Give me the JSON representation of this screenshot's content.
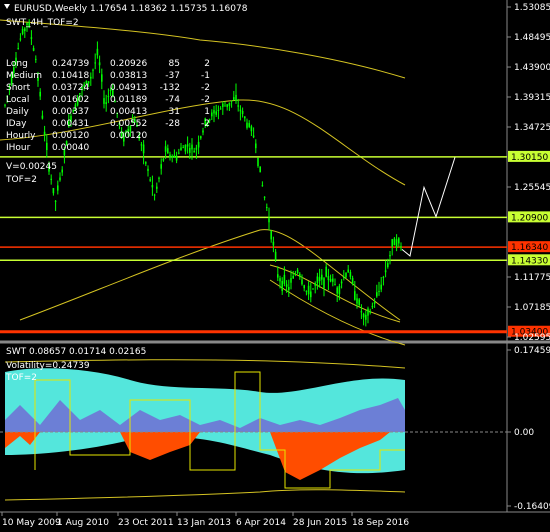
{
  "header": {
    "symbol_line": "EURUSD,Weekly  1.17654 1.18362 1.15735 1.16078",
    "indicator_name": "SWT_4H_TOF=2"
  },
  "stats": {
    "rows": [
      {
        "label": "Long",
        "v1": "0.24739",
        "v2": "0.20926",
        "v3": "85",
        "v4": "2"
      },
      {
        "label": "Medium",
        "v1": "0.10418",
        "v2": "0.03813",
        "v3": "-37",
        "v4": "-1"
      },
      {
        "label": "Short",
        "v1": "0.03724",
        "v2": "0.04913",
        "v3": "-132",
        "v4": "-2"
      },
      {
        "label": "Local",
        "v1": "0.01602",
        "v2": "0.01189",
        "v3": "-74",
        "v4": "-2"
      },
      {
        "label": "Daily",
        "v1": "0.00337",
        "v2": "0.00413",
        "v3": "31",
        "v4": "1"
      },
      {
        "label": "IDay",
        "v1": "0.00431",
        "v2": "0.00552",
        "v3": "-28",
        "v4": "-2"
      },
      {
        "label": "Hourly",
        "v1": "0.00120",
        "v2": "0.00120",
        "v3": "",
        "v4": ""
      },
      {
        "label": "IHour",
        "v1": "0.00040",
        "v2": "",
        "v3": "",
        "v4": ""
      }
    ],
    "v_line": "V=0.00245",
    "tof_line": "TOF=2"
  },
  "sub": {
    "header_line": "SWT  0.08657 0.01714 0.02165",
    "volatility_line": "Volatility=0.24739",
    "tof_line": "TOF=2"
  },
  "price_axis": {
    "ticks": [
      "1.53085",
      "1.48495",
      "1.43900",
      "1.39315",
      "1.34725",
      "1.30150",
      "1.25545",
      "1.20900",
      "1.16340",
      "1.14330",
      "1.11775",
      "1.07185",
      "1.03400",
      "1.02595"
    ]
  },
  "price_levels": [
    {
      "value": "1.30150",
      "color": "#c8ff33"
    },
    {
      "value": "1.20900",
      "color": "#c8ff33"
    },
    {
      "value": "1.16340",
      "color": "#ff3300"
    },
    {
      "value": "1.14330",
      "color": "#c8ff33"
    },
    {
      "value": "1.03400",
      "color": "#ff3300"
    }
  ],
  "sub_axis": {
    "ticks": [
      "0.17459",
      "0.00",
      "-0.16409"
    ]
  },
  "time_axis": {
    "ticks": [
      "10 May 2009",
      "1 Aug 2010",
      "23 Oct 2011",
      "13 Jan 2013",
      "6 Apr 2014",
      "28 Jun 2015",
      "18 Sep 2016"
    ]
  },
  "colors": {
    "candle": "#00ff00",
    "band": "#d4c322",
    "level_green": "#c8ff33",
    "level_red": "#ff3300",
    "volatility_fill": "#54e6dc",
    "histogram_orange": "#ff4d00",
    "histogram_blue": "#6c7fd6"
  }
}
